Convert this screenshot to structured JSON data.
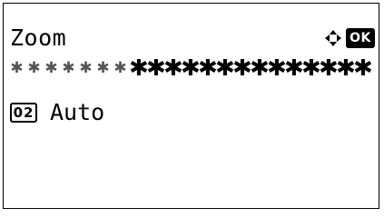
{
  "screen": {
    "title": "Zoom",
    "nav_icon": "four-way-arrows-icon",
    "ok_label": "OK",
    "separator": "✱✱✱✱✱✱✱✱✱✱✱✱✱✱✱✱✱✱✱✱✱"
  },
  "options": [
    {
      "number": "02",
      "label": "Auto"
    }
  ]
}
